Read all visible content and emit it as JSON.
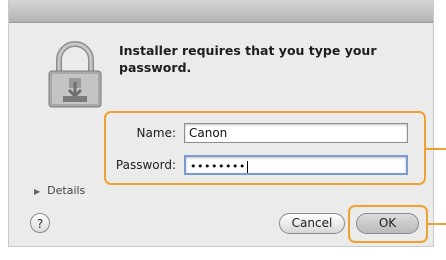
{
  "dialog": {
    "message": "Installer requires that you type your password."
  },
  "form": {
    "name_label": "Name:",
    "name_value": "Canon",
    "password_label": "Password:",
    "password_value": "••••••••"
  },
  "details_label": "Details",
  "help_label": "?",
  "buttons": {
    "cancel_label": "Cancel",
    "ok_label": "OK"
  },
  "colors": {
    "highlight": "#f0a030",
    "dialog_bg": "#ebebeb"
  },
  "icons": {
    "lock": "lock-icon",
    "details": "disclosure-triangle-icon"
  }
}
